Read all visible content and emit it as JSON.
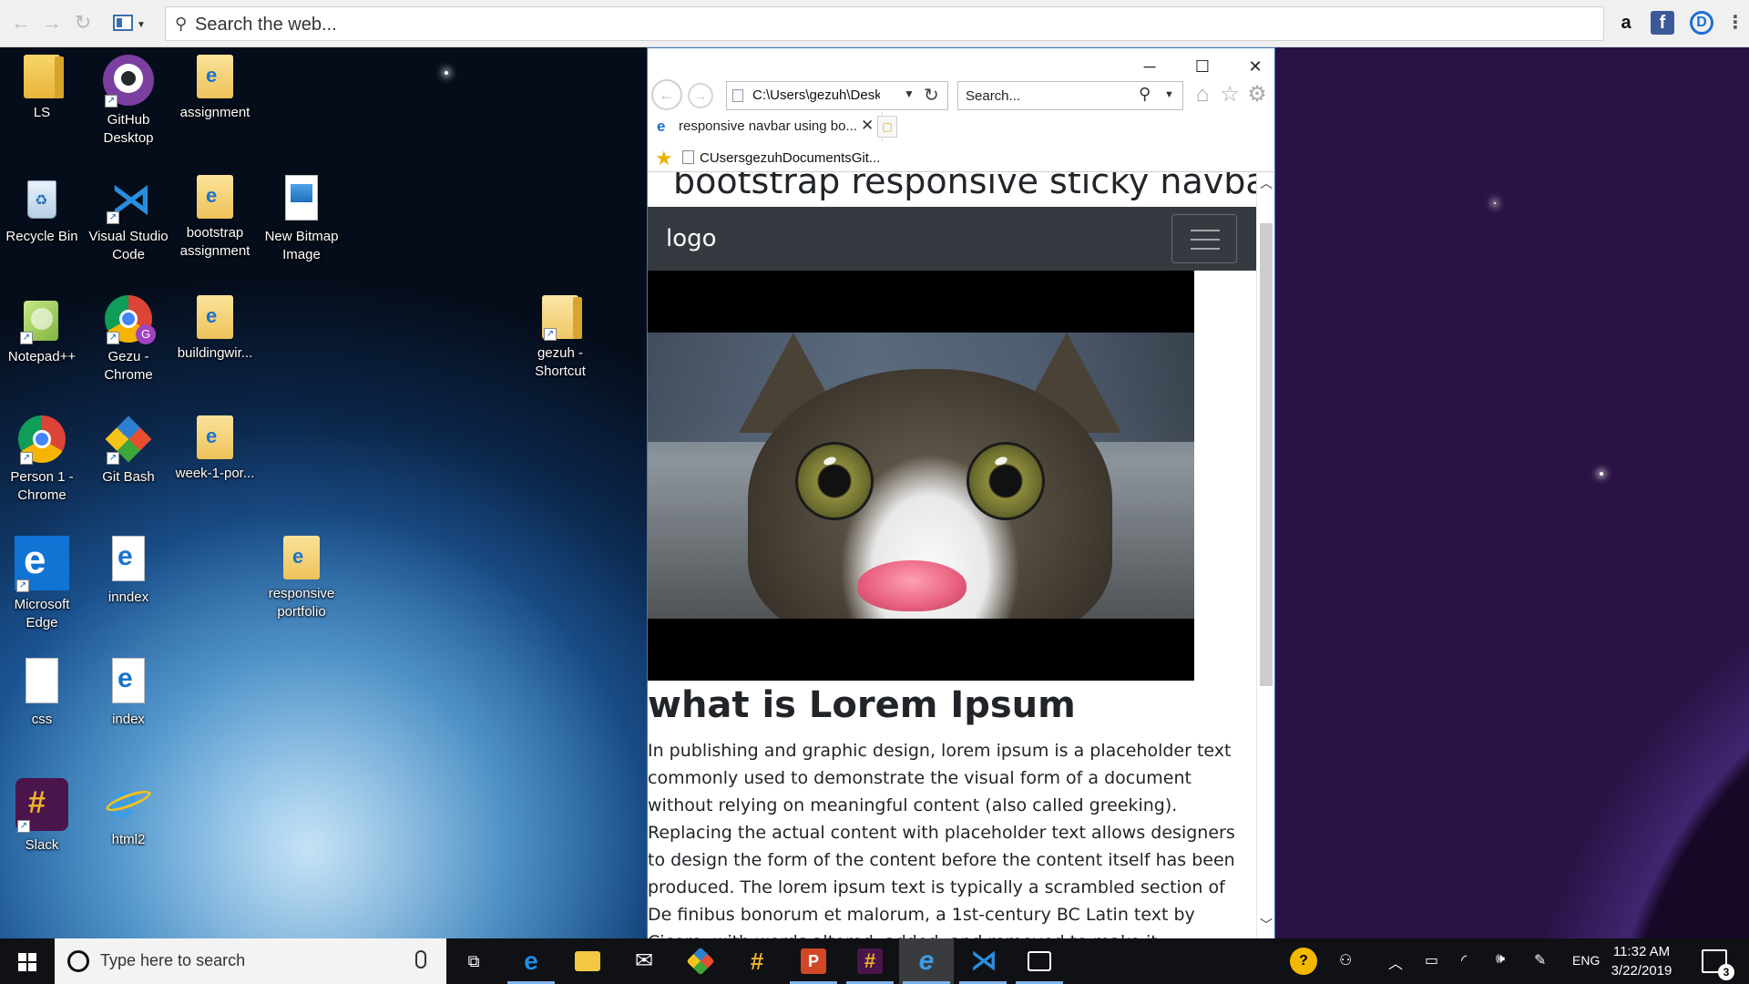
{
  "top_toolbar": {
    "search_placeholder": "Search the web...",
    "extensions": [
      {
        "name": "amazon-icon",
        "glyph": "a"
      },
      {
        "name": "facebook-icon",
        "glyph": "f"
      },
      {
        "name": "dashlane-icon",
        "glyph": "D"
      }
    ]
  },
  "desktop": {
    "icons": [
      {
        "label": "LS",
        "icon": "folder-icon"
      },
      {
        "label": "GitHub\nDesktop",
        "icon": "github-desktop-icon"
      },
      {
        "label": "assignment",
        "icon": "folder-ie-icon"
      },
      {
        "label": "Recycle Bin",
        "icon": "recycle-bin-icon"
      },
      {
        "label": "Visual Studio\nCode",
        "icon": "vscode-icon"
      },
      {
        "label": "bootstrap\nassignment",
        "icon": "folder-ie-icon"
      },
      {
        "label": "New Bitmap\nImage",
        "icon": "bitmap-icon"
      },
      {
        "label": "Notepad++",
        "icon": "notepadpp-icon"
      },
      {
        "label": "Gezu -\nChrome",
        "icon": "chrome-icon"
      },
      {
        "label": "buildingwir...",
        "icon": "folder-ie-icon"
      },
      {
        "label": "gezuh -\nShortcut",
        "icon": "folder-icon"
      },
      {
        "label": "Person 1 -\nChrome",
        "icon": "chrome-icon"
      },
      {
        "label": "Git Bash",
        "icon": "git-bash-icon"
      },
      {
        "label": "week-1-por...",
        "icon": "folder-ie-icon"
      },
      {
        "label": "Microsoft\nEdge",
        "icon": "edge-icon"
      },
      {
        "label": "inndex",
        "icon": "ie-file-icon"
      },
      {
        "label": "responsive\nportfolio",
        "icon": "folder-ie-icon"
      },
      {
        "label": "css",
        "icon": "blank-file-icon"
      },
      {
        "label": "index",
        "icon": "ie-file-icon"
      },
      {
        "label": "Slack",
        "icon": "slack-icon"
      },
      {
        "label": "html2",
        "icon": "ie-icon"
      }
    ]
  },
  "browser": {
    "address": "C:\\Users\\gezuh\\Deskto",
    "search_placeholder": "Search...",
    "tab_title": "responsive navbar using bo...",
    "favorite_link": "CUsersgezuhDocumentsGit...",
    "page": {
      "heading": "bootstrap responsive sticky navbar",
      "logo": "logo",
      "content_title": "what is Lorem Ipsum",
      "content_body": "In publishing and graphic design, lorem ipsum is a placeholder text commonly used to demonstrate the visual form of a document without relying on meaningful content (also called greeking). Replacing the actual content with placeholder text allows designers to design the form of the content before the content itself has been produced. The lorem ipsum text is typically a scrambled section of De finibus bonorum et malorum, a 1st-century BC Latin text by Cicero, with words altered, added, and removed to make it nonsensical, improper Latin. A variation of the ordinary lorem"
    }
  },
  "taskbar": {
    "search_placeholder": "Type here to search",
    "language": "ENG",
    "time": "11:32 AM",
    "date": "3/22/2019",
    "notification_count": "3"
  }
}
